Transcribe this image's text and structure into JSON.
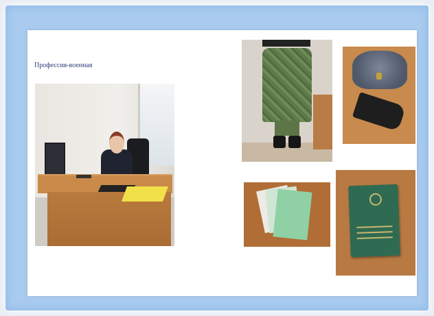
{
  "slide": {
    "title": "Профессия-военная"
  },
  "photos": [
    {
      "subject": "office-desk-officer"
    },
    {
      "subject": "camouflage-uniform-on-hanger"
    },
    {
      "subject": "fur-hat-and-holster"
    },
    {
      "subject": "documents-booklets"
    },
    {
      "subject": "military-id-card"
    }
  ],
  "colors": {
    "frame": "#a9cbef",
    "title_text": "#2b3f78",
    "slide_bg": "#ffffff"
  }
}
